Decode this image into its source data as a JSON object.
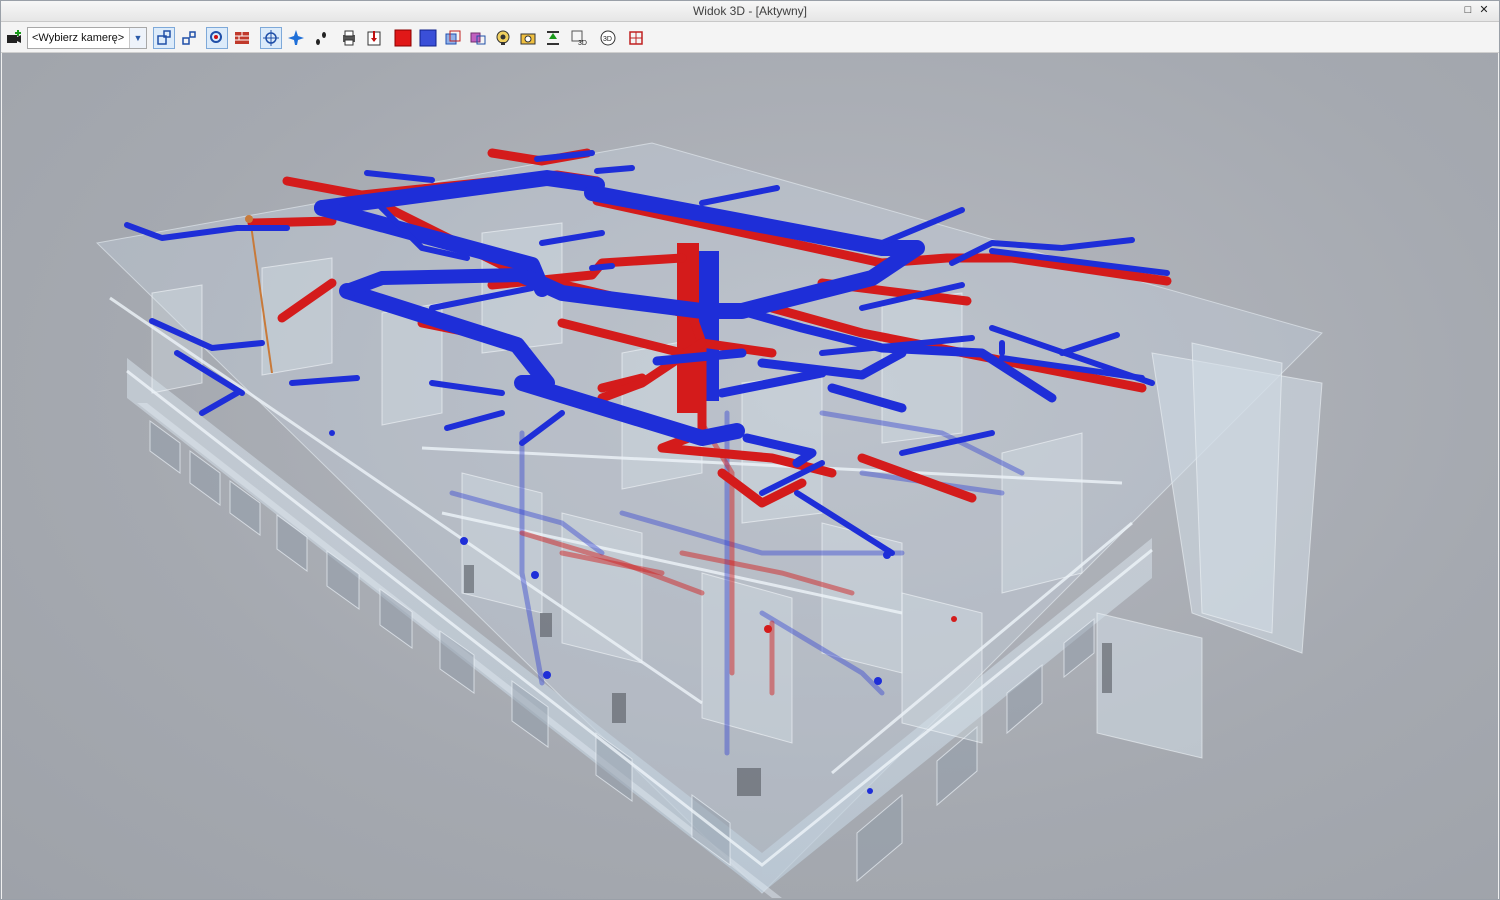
{
  "window": {
    "title": "Widok 3D - [Aktywny]",
    "restore_glyph": "□",
    "close_glyph": "✕"
  },
  "toolbar": {
    "camera_select": {
      "value": "<Wybierz kamerę>"
    },
    "tools": [
      {
        "name": "add-camera-icon"
      },
      {
        "name": "orbit-icon"
      },
      {
        "name": "pan-icon"
      },
      {
        "name": "zoom-region-icon"
      },
      {
        "name": "wall-icon"
      },
      {
        "name": "navigate-icon"
      },
      {
        "name": "fly-icon"
      },
      {
        "name": "walk-icon"
      },
      {
        "name": "print-icon"
      },
      {
        "name": "export-icon"
      },
      {
        "name": "red-color-icon"
      },
      {
        "name": "blue-color-icon"
      },
      {
        "name": "layers-icon"
      },
      {
        "name": "filter-icon"
      },
      {
        "name": "render-icon"
      },
      {
        "name": "snapshot-icon"
      },
      {
        "name": "level-icon"
      },
      {
        "name": "3d-view-icon"
      },
      {
        "name": "rotate-3d-icon"
      },
      {
        "name": "section-icon"
      }
    ]
  },
  "colors": {
    "supply_duct": "#1e2ed8",
    "return_duct": "#d41b1b",
    "building": "#c9d6e2",
    "viewport_bg": "#a9adb4"
  }
}
